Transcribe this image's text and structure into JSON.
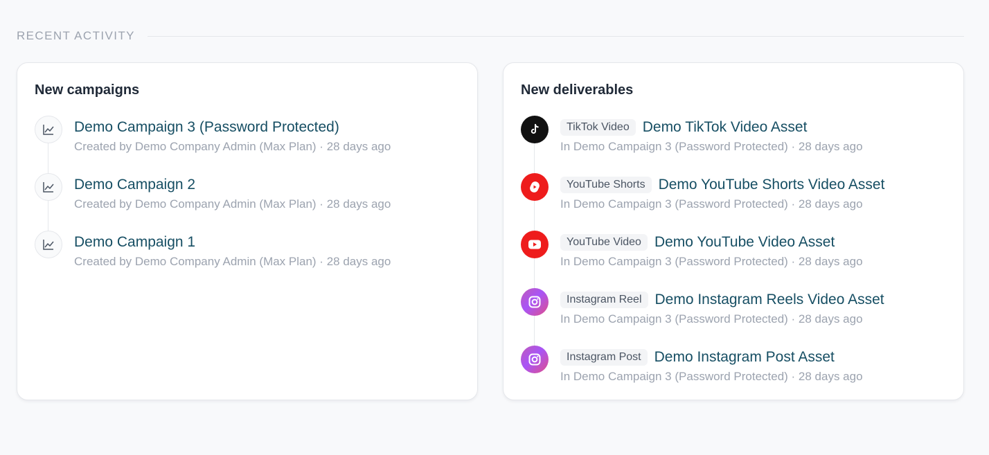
{
  "section": {
    "title": "RECENT ACTIVITY"
  },
  "campaigns": {
    "title": "New campaigns",
    "items": [
      {
        "title": "Demo Campaign 3 (Password Protected)",
        "meta": "Created by Demo Company Admin (Max Plan) · 28 days ago",
        "icon": "line-chart-icon"
      },
      {
        "title": "Demo Campaign 2",
        "meta": "Created by Demo Company Admin (Max Plan) · 28 days ago",
        "icon": "line-chart-icon"
      },
      {
        "title": "Demo Campaign 1",
        "meta": "Created by Demo Company Admin (Max Plan) · 28 days ago",
        "icon": "line-chart-icon"
      }
    ]
  },
  "deliverables": {
    "title": "New deliverables",
    "items": [
      {
        "badge": "TikTok Video",
        "title": "Demo TikTok Video Asset",
        "meta": "In Demo Campaign 3 (Password Protected) · 28 days ago",
        "icon": "tiktok-icon"
      },
      {
        "badge": "YouTube Shorts",
        "title": "Demo YouTube Shorts Video Asset",
        "meta": "In Demo Campaign 3 (Password Protected) · 28 days ago",
        "icon": "youtube-shorts-icon"
      },
      {
        "badge": "YouTube Video",
        "title": "Demo YouTube Video Asset",
        "meta": "In Demo Campaign 3 (Password Protected) · 28 days ago",
        "icon": "youtube-icon"
      },
      {
        "badge": "Instagram Reel",
        "title": "Demo Instagram Reels Video Asset",
        "meta": "In Demo Campaign 3 (Password Protected) · 28 days ago",
        "icon": "instagram-icon"
      },
      {
        "badge": "Instagram Post",
        "title": "Demo Instagram Post Asset",
        "meta": "In Demo Campaign 3 (Password Protected) · 28 days ago",
        "icon": "instagram-icon"
      }
    ]
  },
  "colors": {
    "link": "#164e63",
    "muted": "#9ca3af",
    "youtube": "#ee1c1c",
    "tiktok": "#111111"
  }
}
